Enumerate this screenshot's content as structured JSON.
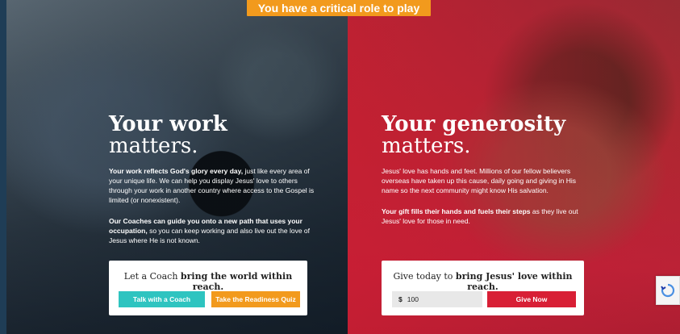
{
  "banner": {
    "text": "You have a critical role to play"
  },
  "work": {
    "heading_bold": "Your work",
    "heading_light": "matters.",
    "para1_bold": "Your work reflects God's glory every day,",
    "para1_rest": " just like every area of your unique life. We can help you display Jesus' love to others through your work in another country where access to the Gospel is limited (or nonexistent).",
    "para2_bold": "Our Coaches can guide you onto a new path that uses your occupation,",
    "para2_rest": " so you can keep working and also live out the love of Jesus where He is not known.",
    "cta_prefix": "Let a Coach ",
    "cta_bold": "bring the world within reach.",
    "btn_coach": "Talk with a Coach",
    "btn_quiz": "Take the Readiness Quiz"
  },
  "generosity": {
    "heading_bold": "Your generosity",
    "heading_light": "matters.",
    "para1": "Jesus' love has hands and feet. Millions of our fellow believers overseas have taken up this cause, daily going and giving in His name so the next community might know His salvation.",
    "para2_bold": "Your gift fills their hands and fuels their steps",
    "para2_rest": " as they live out Jesus' love for those in need.",
    "cta_prefix": "Give today to ",
    "cta_bold": "bring Jesus' love within reach.",
    "currency": "$",
    "amount": "100",
    "btn_give": "Give Now"
  },
  "colors": {
    "teal": "#2ec4c0",
    "orange": "#f29a1d",
    "red": "#d81f35"
  }
}
